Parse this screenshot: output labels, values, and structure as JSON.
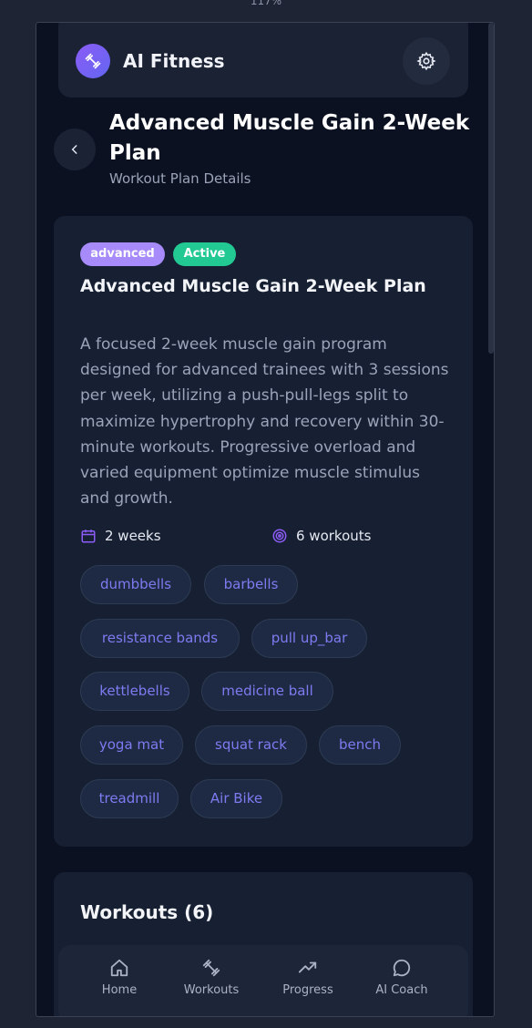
{
  "zoom": "117%",
  "app": {
    "brand": "AI Fitness",
    "logo_icon": "dumbbell-icon",
    "settings_icon": "gear-icon"
  },
  "page": {
    "title": "Advanced Muscle Gain 2-Week Plan",
    "subtitle": "Workout Plan Details",
    "back_icon": "chevron-left-icon"
  },
  "plan": {
    "level": "advanced",
    "status": "Active",
    "title": "Advanced Muscle Gain 2-Week Plan",
    "description": "A focused 2-week muscle gain program designed for advanced trainees with 3 sessions per week, utilizing a push-pull-legs split to maximize hypertrophy and recovery within 30-minute workouts. Progressive overload and varied equipment optimize muscle stimulus and growth.",
    "duration": "2 weeks",
    "workouts_count": "6 workouts",
    "equipment": [
      "dumbbells",
      "barbells",
      "resistance bands",
      "pull up_bar",
      "kettlebells",
      "medicine ball",
      "yoga mat",
      "squat rack",
      "bench",
      "treadmill",
      "Air Bike"
    ]
  },
  "workouts_section": {
    "title": "Workouts (6)"
  },
  "nav": {
    "items": [
      {
        "label": "Home",
        "icon": "home-icon"
      },
      {
        "label": "Workouts",
        "icon": "dumbbell-icon"
      },
      {
        "label": "Progress",
        "icon": "trending-up-icon"
      },
      {
        "label": "AI Coach",
        "icon": "chat-bubble-icon"
      }
    ]
  },
  "colors": {
    "background": "#0b1120",
    "card": "#172033",
    "accent_purple": "#a78bfa",
    "accent_green": "#22c993",
    "chip_text": "#7c7cf0"
  }
}
